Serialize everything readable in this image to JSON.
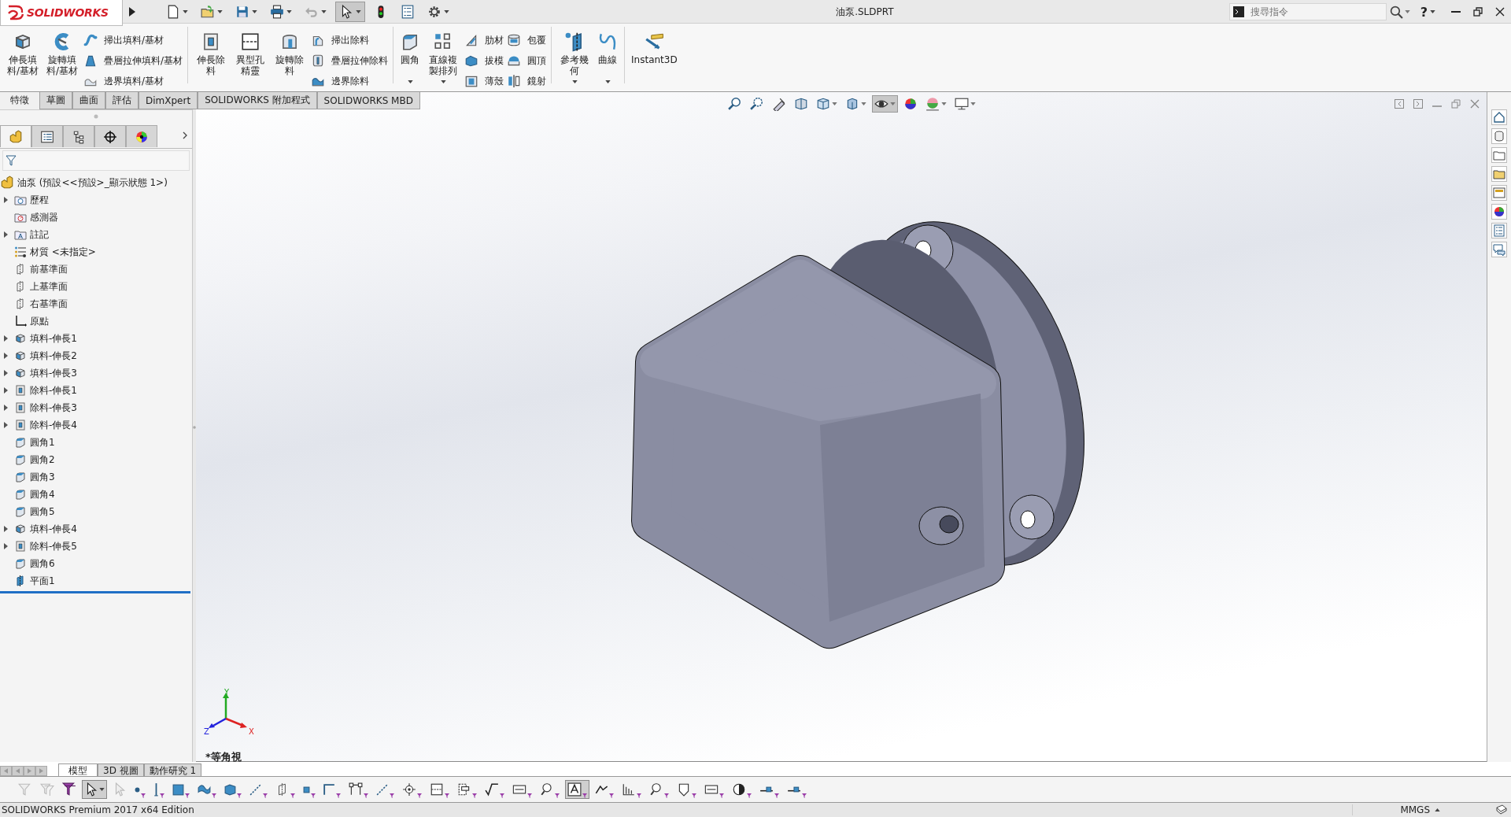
{
  "title_bar": {
    "logo": "SOLIDWORKS",
    "document_title": "油泵.SLDPRT",
    "search": {
      "placeholder": "搜尋指令"
    },
    "help": "?",
    "tools": [
      {
        "kind": "new",
        "dropdown": true,
        "pressed": false
      },
      {
        "kind": "open",
        "dropdown": true,
        "pressed": false
      },
      {
        "kind": "save",
        "dropdown": true,
        "pressed": false
      },
      {
        "kind": "print",
        "dropdown": true,
        "pressed": false
      },
      {
        "kind": "undo",
        "dropdown": true,
        "pressed": false
      },
      {
        "kind": "select",
        "dropdown": true,
        "pressed": true
      },
      {
        "kind": "rebuild",
        "dropdown": false,
        "pressed": false
      },
      {
        "kind": "fileprops",
        "dropdown": false,
        "pressed": false
      },
      {
        "kind": "options",
        "dropdown": true,
        "pressed": false
      }
    ]
  },
  "ribbon": {
    "groups": [
      {
        "items": [
          {
            "kind": "large",
            "label": "伸長填料/基材",
            "dropdown": false
          },
          {
            "kind": "large",
            "label": "旋轉填料/基材",
            "dropdown": false
          },
          {
            "kind": "small",
            "label": "掃出填料/基材"
          },
          {
            "kind": "small",
            "label": "疊層拉伸填料/基材"
          },
          {
            "kind": "small",
            "label": "邊界填料/基材"
          }
        ]
      },
      {
        "items": [
          {
            "kind": "large",
            "label": "伸長除料",
            "dropdown": false
          },
          {
            "kind": "large",
            "label": "異型孔精靈",
            "dropdown": false
          },
          {
            "kind": "large",
            "label": "旋轉除料",
            "dropdown": false
          },
          {
            "kind": "small",
            "label": "掃出除料"
          },
          {
            "kind": "small",
            "label": "疊層拉伸除料"
          },
          {
            "kind": "small",
            "label": "邊界除料"
          }
        ]
      },
      {
        "items": [
          {
            "kind": "large",
            "label": "圓角",
            "dropdown": true
          },
          {
            "kind": "large",
            "label": "直線複製排列",
            "dropdown": true
          },
          {
            "kind": "small",
            "label": "肋材"
          },
          {
            "kind": "small",
            "label": "拔模"
          },
          {
            "kind": "small",
            "label": "薄殼"
          },
          {
            "kind": "small",
            "label": "包覆"
          },
          {
            "kind": "small",
            "label": "圓頂"
          },
          {
            "kind": "small",
            "label": "鏡射"
          }
        ]
      },
      {
        "items": [
          {
            "kind": "large",
            "label": "參考幾何",
            "dropdown": true
          },
          {
            "kind": "large",
            "label": "曲線",
            "dropdown": true
          }
        ]
      },
      {
        "items": [
          {
            "kind": "large",
            "label": "Instant3D",
            "dropdown": false
          }
        ]
      }
    ]
  },
  "command_tabs": [
    {
      "label": "特徵",
      "selected": true
    },
    {
      "label": "草圖",
      "selected": false
    },
    {
      "label": "曲面",
      "selected": false
    },
    {
      "label": "評估",
      "selected": false
    },
    {
      "label": "DimXpert",
      "selected": false
    },
    {
      "label": "SOLIDWORKS 附加程式",
      "selected": false
    },
    {
      "label": "SOLIDWORKS MBD",
      "selected": false
    }
  ],
  "panel_tabs": [
    {
      "kind": "part",
      "selected": true
    },
    {
      "kind": "property",
      "selected": false
    },
    {
      "kind": "config",
      "selected": false
    },
    {
      "kind": "dimxpert",
      "selected": false
    },
    {
      "kind": "display",
      "selected": false
    }
  ],
  "feature_tree": {
    "root": {
      "label": "油泵 (預設<<預設>_顯示狀態 1>)",
      "kind": "part"
    },
    "items": [
      {
        "label": "歷程",
        "kind": "history",
        "expandable": true
      },
      {
        "label": "感測器",
        "kind": "sensor",
        "expandable": false
      },
      {
        "label": "註記",
        "kind": "annotation",
        "expandable": true
      },
      {
        "label": "材質 <未指定>",
        "kind": "material",
        "expandable": false
      },
      {
        "label": "前基準面",
        "kind": "plane",
        "expandable": false
      },
      {
        "label": "上基準面",
        "kind": "plane",
        "expandable": false
      },
      {
        "label": "右基準面",
        "kind": "plane",
        "expandable": false
      },
      {
        "label": "原點",
        "kind": "origin",
        "expandable": false
      },
      {
        "label": "填料-伸長1",
        "kind": "boss",
        "expandable": true
      },
      {
        "label": "填料-伸長2",
        "kind": "boss",
        "expandable": true
      },
      {
        "label": "填料-伸長3",
        "kind": "boss",
        "expandable": true
      },
      {
        "label": "除料-伸長1",
        "kind": "cut",
        "expandable": true
      },
      {
        "label": "除料-伸長3",
        "kind": "cut",
        "expandable": true
      },
      {
        "label": "除料-伸長4",
        "kind": "cut",
        "expandable": true
      },
      {
        "label": "圓角1",
        "kind": "fillet",
        "expandable": false
      },
      {
        "label": "圓角2",
        "kind": "fillet",
        "expandable": false
      },
      {
        "label": "圓角3",
        "kind": "fillet",
        "expandable": false
      },
      {
        "label": "圓角4",
        "kind": "fillet",
        "expandable": false
      },
      {
        "label": "圓角5",
        "kind": "fillet",
        "expandable": false
      },
      {
        "label": "填料-伸長4",
        "kind": "boss",
        "expandable": true
      },
      {
        "label": "除料-伸長5",
        "kind": "cut",
        "expandable": true
      },
      {
        "label": "圓角6",
        "kind": "fillet",
        "expandable": false
      },
      {
        "label": "平面1",
        "kind": "planesolid",
        "expandable": false
      }
    ]
  },
  "viewport": {
    "view_name": "*等角視",
    "triad": {
      "y": "Y",
      "x": "X",
      "z": "Z"
    },
    "heads_up": [
      {
        "kind": "zoomfit",
        "dropdown": false,
        "pressed": false
      },
      {
        "kind": "zoomarea",
        "dropdown": false,
        "pressed": false
      },
      {
        "kind": "previous",
        "dropdown": false,
        "pressed": false
      },
      {
        "kind": "section",
        "dropdown": false,
        "pressed": false
      },
      {
        "kind": "orient",
        "dropdown": true,
        "pressed": false
      },
      {
        "kind": "style",
        "dropdown": true,
        "pressed": false
      },
      {
        "kind": "hideshow",
        "dropdown": true,
        "pressed": true
      },
      {
        "kind": "appearance",
        "dropdown": false,
        "pressed": false
      },
      {
        "kind": "scene",
        "dropdown": true,
        "pressed": false
      },
      {
        "kind": "monitor",
        "dropdown": true,
        "pressed": false
      }
    ]
  },
  "task_pane": [
    {
      "kind": "home"
    },
    {
      "kind": "resources"
    },
    {
      "kind": "library"
    },
    {
      "kind": "explorer"
    },
    {
      "kind": "palette"
    },
    {
      "kind": "appearance"
    },
    {
      "kind": "fileprops"
    },
    {
      "kind": "forum"
    }
  ],
  "model_tabs": [
    {
      "label": "模型",
      "selected": true
    },
    {
      "label": "3D 視圖",
      "selected": false
    },
    {
      "label": "動作研究 1",
      "selected": false
    }
  ],
  "filter_toolbar": [
    {
      "kind": "f1",
      "pressed": false
    },
    {
      "kind": "f2",
      "pressed": false
    },
    {
      "kind": "f3",
      "pressed": false
    },
    {
      "kind": "select",
      "pressed": true
    },
    {
      "kind": "f4",
      "pressed": false
    },
    {
      "kind": "point",
      "pressed": false
    },
    {
      "kind": "axis",
      "pressed": false
    },
    {
      "kind": "face",
      "pressed": false
    },
    {
      "kind": "surface",
      "pressed": false
    },
    {
      "kind": "solid",
      "pressed": false
    },
    {
      "kind": "line",
      "pressed": false
    },
    {
      "kind": "plane",
      "pressed": false
    },
    {
      "kind": "vertex",
      "pressed": false
    },
    {
      "kind": "edge",
      "pressed": false
    },
    {
      "kind": "path",
      "pressed": false
    },
    {
      "kind": "line",
      "pressed": false
    },
    {
      "kind": "target",
      "pressed": false
    },
    {
      "kind": "hole",
      "pressed": false
    },
    {
      "kind": "tag",
      "pressed": false
    },
    {
      "kind": "check",
      "pressed": false
    },
    {
      "kind": "note",
      "pressed": false
    },
    {
      "kind": "balloon",
      "pressed": false
    },
    {
      "kind": "text",
      "pressed": true
    },
    {
      "kind": "weld",
      "pressed": false
    },
    {
      "kind": "hatch",
      "pressed": false
    },
    {
      "kind": "balloon",
      "pressed": false
    },
    {
      "kind": "shield",
      "pressed": false
    },
    {
      "kind": "note",
      "pressed": false
    },
    {
      "kind": "pie",
      "pressed": false
    },
    {
      "kind": "connector",
      "pressed": false
    },
    {
      "kind": "connector",
      "pressed": false
    }
  ],
  "status_bar": {
    "product": "SOLIDWORKS Premium 2017 x64 Edition",
    "units": "MMGS"
  }
}
